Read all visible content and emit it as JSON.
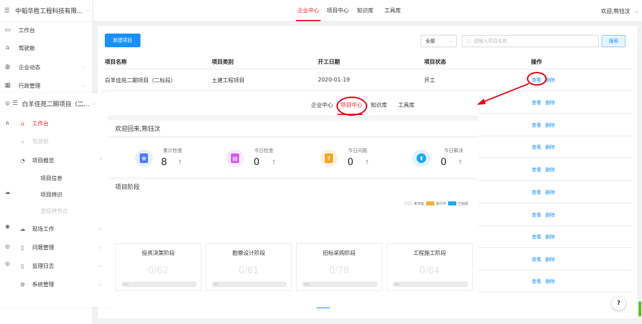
{
  "bg_sidebar": {
    "company": "中韬华胜工程科技有限...",
    "items": [
      "工作台",
      "驾驶舱",
      "企业动态",
      "行政管理"
    ]
  },
  "bg_topbar": {
    "tabs": [
      "企业中心",
      "项目中心",
      "知识库",
      "工具库"
    ],
    "user": "欢迎,熊钰汶"
  },
  "bg_toolbar": {
    "new_button": "新建项目",
    "filter_value": "全部",
    "search_placeholder": "请输入项目名称",
    "search_button": "搜索"
  },
  "bg_table": {
    "headers": [
      "项目名称",
      "项目类别",
      "开工日期",
      "项目状态",
      "操作"
    ],
    "first_row": {
      "name": "白羊佳苑二期项目（二标段）",
      "category": "土建工程项目",
      "start_date": "2020-01-19",
      "status": "开工"
    },
    "actions": {
      "view": "查看",
      "delete": "删除"
    }
  },
  "help": "?",
  "overlay": {
    "project_title": "白羊佳苑二期项目（二...",
    "tabs": [
      "企业中心",
      "项目中心",
      "知识库",
      "工具库"
    ],
    "menu": {
      "workbench": "工作台",
      "cockpit": "驾驶舱",
      "overview": "项目概览",
      "sub_info": "项目信息",
      "sub_recognize": "项目辨识",
      "sub_milestone": "里程碑节点",
      "site": "现场工作",
      "problems": "问题管理",
      "log": "监理日志",
      "system": "系统管理"
    },
    "welcome": "欢迎回来,熊钰汶",
    "stats": [
      {
        "label": "累计检查",
        "value": "8"
      },
      {
        "label": "今日检查",
        "value": "0"
      },
      {
        "label": "今日问题",
        "value": "0"
      },
      {
        "label": "今日解决",
        "value": "0"
      }
    ],
    "stat_arrow": "↑",
    "phase_title": "项目阶段",
    "legend": [
      "未开始",
      "进行中",
      "已完成"
    ],
    "phases": [
      {
        "name": "投资决策阶段",
        "count": "0/62"
      },
      {
        "name": "勘察设计阶段",
        "count": "0/61"
      },
      {
        "name": "招标采购阶段",
        "count": "0/78"
      },
      {
        "name": "工程施工阶段",
        "count": "0/84"
      }
    ],
    "bar_text": "0%"
  }
}
